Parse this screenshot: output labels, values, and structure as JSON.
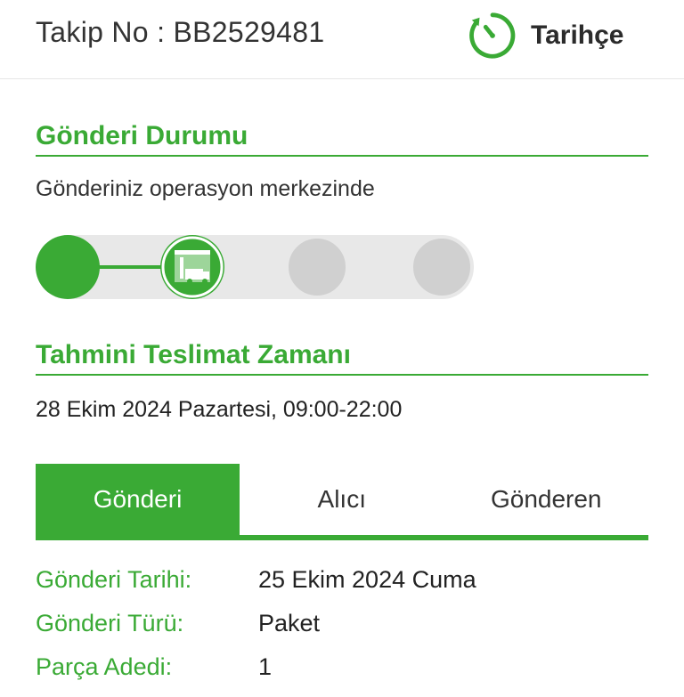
{
  "header": {
    "tracking": "Takip No : BB2529481",
    "history_label": "Tarihçe"
  },
  "status": {
    "title": "Gönderi Durumu",
    "text": "Gönderiniz operasyon merkezinde",
    "steps_total": 4,
    "current_step": 2
  },
  "eta": {
    "title": "Tahmini Teslimat Zamanı",
    "text": "28 Ekim 2024 Pazartesi, 09:00-22:00"
  },
  "tabs": [
    {
      "label": "Gönderi",
      "active": true
    },
    {
      "label": "Alıcı",
      "active": false
    },
    {
      "label": "Gönderen",
      "active": false
    }
  ],
  "details": [
    {
      "label": "Gönderi Tarihi:",
      "value": "25 Ekim 2024 Cuma"
    },
    {
      "label": "Gönderi Türü:",
      "value": "Paket"
    },
    {
      "label": "Parça Adedi:",
      "value": "1"
    }
  ],
  "colors": {
    "accent": "#3aaa35",
    "inactive_step": "#d0d0d0"
  }
}
